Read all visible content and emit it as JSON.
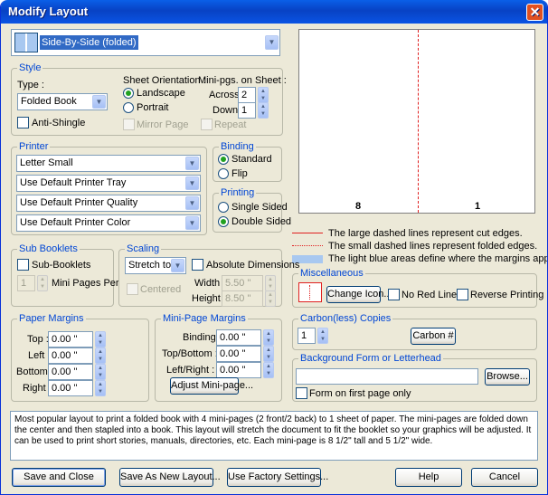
{
  "window": {
    "title": "Modify Layout",
    "close": "✕"
  },
  "layout_select": {
    "value": "Side-By-Side (folded)"
  },
  "preview": {
    "left_page": "8",
    "right_page": "1"
  },
  "legend": {
    "large_dash": "The large dashed lines represent cut edges.",
    "small_dash": "The small dashed lines represent folded edges.",
    "light_blue": "The light blue areas define where the margins appear."
  },
  "style": {
    "title": "Style",
    "type_label": "Type :",
    "type_value": "Folded Book",
    "anti_shingle": "Anti-Shingle",
    "orientation_label": "Sheet Orientation :",
    "landscape": "Landscape",
    "portrait": "Portrait",
    "mirror_page": "Mirror Page",
    "minipgs_label": "Mini-pgs. on Sheet :",
    "across_label": "Across:",
    "across_value": "2",
    "down_label": "Down:",
    "down_value": "1",
    "repeat": "Repeat"
  },
  "printer": {
    "title": "Printer",
    "paper": "Letter Small",
    "tray": "Use Default Printer Tray",
    "quality": "Use Default Printer Quality",
    "color": "Use Default Printer Color"
  },
  "binding": {
    "title": "Binding",
    "standard": "Standard",
    "flip": "Flip"
  },
  "printing": {
    "title": "Printing",
    "single": "Single Sided",
    "double": "Double Sided"
  },
  "sub_booklets": {
    "title": "Sub Booklets",
    "check": "Sub-Booklets",
    "count": "1",
    "mini_pages_per": "Mini Pages Per"
  },
  "scaling": {
    "title": "Scaling",
    "mode": "Stretch to fit",
    "absolute": "Absolute Dimensions",
    "centered": "Centered",
    "width_label": "Width :",
    "width_value": "5.50 \"",
    "height_label": "Height :",
    "height_value": "8.50 \""
  },
  "paper_margins": {
    "title": "Paper Margins",
    "top_label": "Top :",
    "top": "0.00 \"",
    "left_label": "Left :",
    "left": "0.00 \"",
    "bottom_label": "Bottom :",
    "bottom": "0.00 \"",
    "right_label": "Right :",
    "right": "0.00 \""
  },
  "minipage_margins": {
    "title": "Mini-Page Margins",
    "binding_label": "Binding :",
    "binding": "0.00 \"",
    "topbottom_label": "Top/Bottom :",
    "topbottom": "0.00 \"",
    "leftright_label": "Left/Right :",
    "leftright": "0.00 \"",
    "adjust_button": "Adjust Mini-page..."
  },
  "miscellaneous": {
    "title": "Miscellaneous",
    "change_icon": "Change Icon...",
    "no_red_lines": "No Red Lines",
    "reverse_printing": "Reverse Printing"
  },
  "carbon": {
    "title": "Carbon(less) Copies",
    "count": "1",
    "button": "Carbon #"
  },
  "background": {
    "title": "Background Form or Letterhead",
    "path": "",
    "browse": "Browse...",
    "first_page_only": "Form on first page only"
  },
  "description": "Most popular layout to print a folded book with 4 mini-pages (2 front/2 back) to 1 sheet of paper. The mini-pages are folded down the center and then stapled into a book.  This layout will stretch the document to fit the booklet so your graphics will be adjusted.  It can be used to print short stories, manuals, directories, etc.  Each mini-page is 8 1/2\" tall and 5 1/2\" wide.",
  "footer": {
    "save_close": "Save and Close",
    "save_new": "Save As New Layout...",
    "factory": "Use Factory Settings...",
    "help": "Help",
    "cancel": "Cancel"
  },
  "colors": {
    "accent": "#0046d5",
    "cut_line": "#e02020",
    "margin_blue": "#a8c8f0",
    "titlebar": "#0a54e4"
  }
}
